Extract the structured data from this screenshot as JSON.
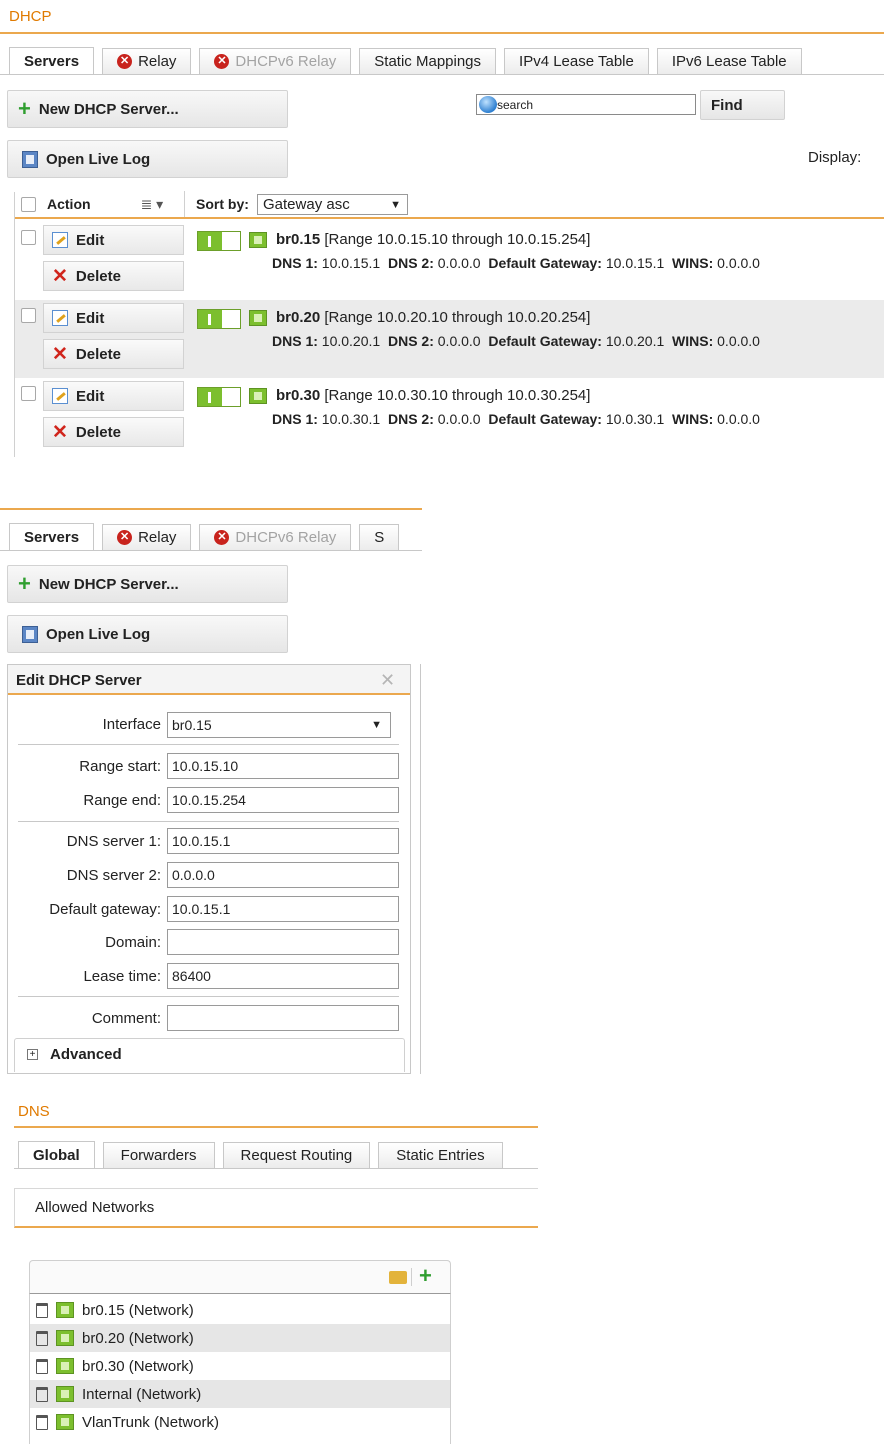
{
  "dhcp": {
    "title": "DHCP",
    "tabs": [
      "Servers",
      "Relay",
      "DHCPv6 Relay",
      "Static Mappings",
      "IPv4 Lease Table",
      "IPv6 Lease Table"
    ],
    "new_server_label": "New DHCP Server...",
    "open_log_label": "Open Live Log",
    "search_placeholder": "search",
    "find_label": "Find",
    "display_label": "Display:",
    "grid": {
      "action_header": "Action",
      "sort_by_label": "Sort by:",
      "sort_value": "Gateway asc",
      "edit_label": "Edit",
      "delete_label": "Delete",
      "rows": [
        {
          "name": "br0.15",
          "range": "[Range 10.0.15.10 through 10.0.15.254]",
          "dns1_label": "DNS 1:",
          "dns1": "10.0.15.1",
          "dns2_label": "DNS 2:",
          "dns2": "0.0.0.0",
          "gw_label": "Default Gateway:",
          "gw": "10.0.15.1",
          "wins_label": "WINS:",
          "wins": "0.0.0.0"
        },
        {
          "name": "br0.20",
          "range": "[Range 10.0.20.10 through 10.0.20.254]",
          "dns1_label": "DNS 1:",
          "dns1": "10.0.20.1",
          "dns2_label": "DNS 2:",
          "dns2": "0.0.0.0",
          "gw_label": "Default Gateway:",
          "gw": "10.0.20.1",
          "wins_label": "WINS:",
          "wins": "0.0.0.0"
        },
        {
          "name": "br0.30",
          "range": "[Range 10.0.30.10 through 10.0.30.254]",
          "dns1_label": "DNS 1:",
          "dns1": "10.0.30.1",
          "dns2_label": "DNS 2:",
          "dns2": "0.0.0.0",
          "gw_label": "Default Gateway:",
          "gw": "10.0.30.1",
          "wins_label": "WINS:",
          "wins": "0.0.0.0"
        }
      ]
    }
  },
  "edit_panel": {
    "tabs": [
      "Servers",
      "Relay",
      "DHCPv6 Relay",
      "S"
    ],
    "new_server_label": "New DHCP Server...",
    "open_log_label": "Open Live Log",
    "title": "Edit DHCP Server",
    "interface_label": "Interface",
    "interface_value": "br0.15",
    "range_start_label": "Range start:",
    "range_start": "10.0.15.10",
    "range_end_label": "Range end:",
    "range_end": "10.0.15.254",
    "dns1_label": "DNS server 1:",
    "dns1": "10.0.15.1",
    "dns2_label": "DNS server 2:",
    "dns2": "0.0.0.0",
    "gateway_label": "Default gateway:",
    "gateway": "10.0.15.1",
    "domain_label": "Domain:",
    "domain": "",
    "lease_label": "Lease time:",
    "lease": "86400",
    "comment_label": "Comment:",
    "comment": "",
    "advanced_label": "Advanced"
  },
  "dns": {
    "title": "DNS",
    "tabs": [
      "Global",
      "Forwarders",
      "Request Routing",
      "Static Entries"
    ],
    "section_label": "Allowed Networks",
    "networks": [
      "br0.15 (Network)",
      "br0.20 (Network)",
      "br0.30 (Network)",
      "Internal (Network)",
      "VlanTrunk (Network)"
    ]
  },
  "colors": {
    "accent": "#e07a00",
    "accent_line": "#eba84e",
    "toggle_on": "#7cbf2e",
    "delete_red": "#d0251c"
  }
}
